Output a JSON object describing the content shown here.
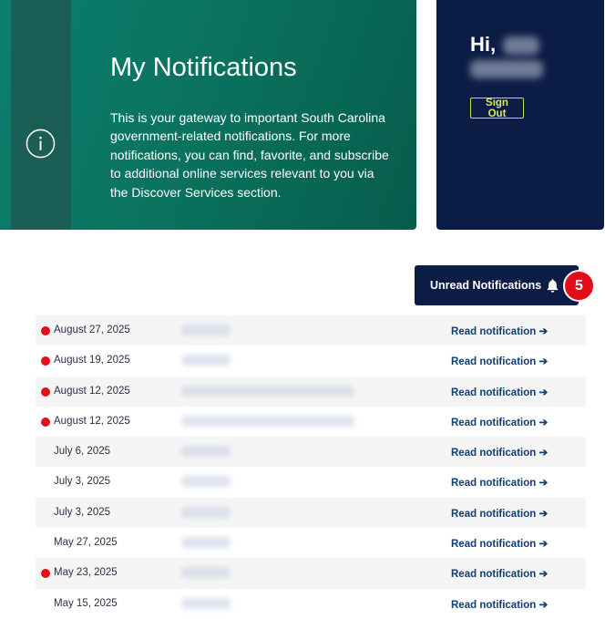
{
  "hero": {
    "title": "My Notifications",
    "description": "This is your gateway to important South Carolina government-related notifications. For more notifications, you can find, favorite, and subscribe to additional online services relevant to you via the Discover Services section."
  },
  "user_card": {
    "greeting": "Hi,",
    "sign_out_label": "Sign Out"
  },
  "unread": {
    "label": "Unread Notifications",
    "count": "5"
  },
  "notifications": [
    {
      "date": "August 27, 2025",
      "unread": true,
      "read_link": "Read notification ➔"
    },
    {
      "date": "August 19, 2025",
      "unread": true,
      "read_link": "Read notification ➔"
    },
    {
      "date": "August 12, 2025",
      "unread": true,
      "read_link": "Read notification ➔"
    },
    {
      "date": "August 12, 2025",
      "unread": true,
      "read_link": "Read notification ➔"
    },
    {
      "date": "July 6, 2025",
      "unread": false,
      "read_link": "Read notification ➔"
    },
    {
      "date": "July 3, 2025",
      "unread": false,
      "read_link": "Read notification ➔"
    },
    {
      "date": "July 3, 2025",
      "unread": false,
      "read_link": "Read notification ➔"
    },
    {
      "date": "May 27, 2025",
      "unread": false,
      "read_link": "Read notification ➔"
    },
    {
      "date": "May 23, 2025",
      "unread": true,
      "read_link": "Read notification ➔"
    },
    {
      "date": "May 15, 2025",
      "unread": false,
      "read_link": "Read notification ➔"
    }
  ]
}
